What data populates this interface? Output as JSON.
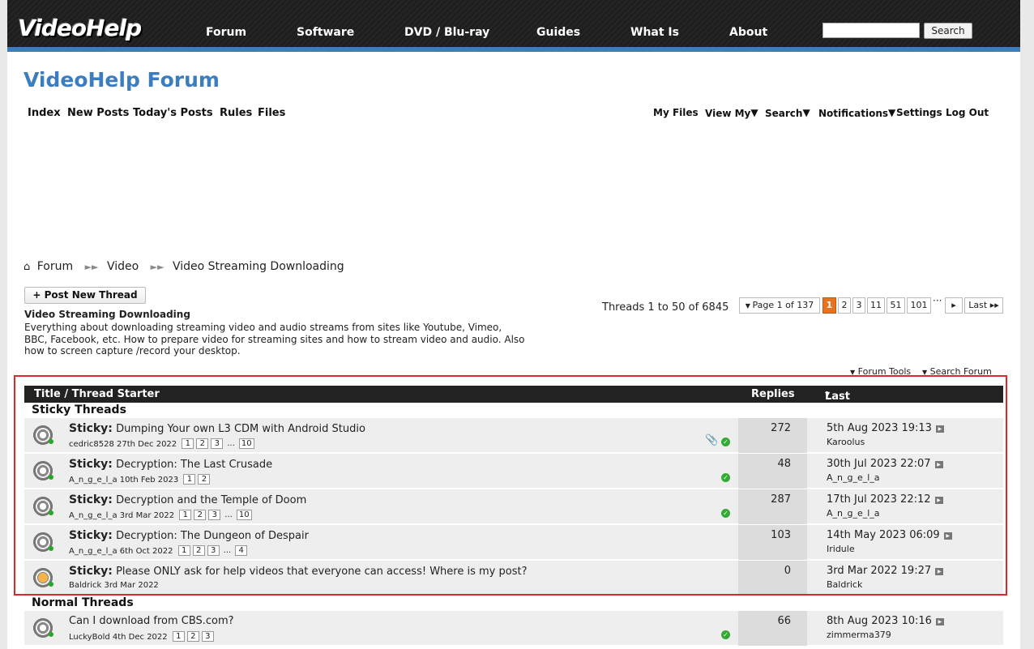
{
  "header": {
    "logo": "VideoHelp",
    "nav": [
      "Forum",
      "Software",
      "DVD / Blu-ray",
      "Guides",
      "What Is",
      "About"
    ],
    "search_button": "Search",
    "search_value": ""
  },
  "forum_title": "VideoHelp Forum",
  "subnav_left": [
    "Index",
    "New Posts",
    "Today's Posts",
    "Rules",
    "Files"
  ],
  "subnav_right": [
    "My Files",
    "View My",
    "Search",
    "Notifications",
    "Settings",
    "Log Out"
  ],
  "breadcrumb": [
    "Forum",
    "Video",
    "Video Streaming Downloading"
  ],
  "post_new_thread": "+ Post New Thread",
  "forum": {
    "name": "Video Streaming Downloading",
    "description": "Everything about downloading streaming video and audio streams from sites like Youtube, Vimeo, BBC, Facebook, etc. How to prepare video for streaming sites and how to stream video and audio. Also how to screen capture /record your desktop."
  },
  "threads_count": "Threads 1 to 50 of 6845",
  "pager": {
    "label": "Page 1 of 137",
    "pages": [
      "1",
      "2",
      "3",
      "11",
      "51",
      "101"
    ],
    "current": "1",
    "last": "Last"
  },
  "tools": {
    "forum_tools": "Forum Tools",
    "search_forum": "Search Forum"
  },
  "table": {
    "col_title": "Title / Thread Starter",
    "col_replies": "Replies",
    "col_last": "Last Post By"
  },
  "sections": {
    "sticky": "Sticky Threads",
    "normal": "Normal Threads"
  },
  "sticky_label": "Sticky:",
  "threads": [
    {
      "title": "Dumping Your own L3 CDM with Android Studio",
      "starter": "cedric8528 27th Dec 2022",
      "pages": [
        "1",
        "2",
        "3",
        "...",
        "10"
      ],
      "replies": "272",
      "last_date": "5th Aug 2023 19:13",
      "last_user": "Karoolus"
    },
    {
      "title": "Decryption: The Last Crusade",
      "starter": "A_n_g_e_l_a 10th Feb 2023",
      "pages": [
        "1",
        "2"
      ],
      "replies": "48",
      "last_date": "30th Jul 2023 22:07",
      "last_user": "A_n_g_e_l_a"
    },
    {
      "title": "Decryption and the Temple of Doom",
      "starter": "A_n_g_e_l_a 3rd Mar 2022",
      "pages": [
        "1",
        "2",
        "3",
        "...",
        "10"
      ],
      "replies": "287",
      "last_date": "17th Jul 2023 22:12",
      "last_user": "A_n_g_e_l_a"
    },
    {
      "title": "Decryption: The Dungeon of Despair",
      "starter": "A_n_g_e_l_a 6th Oct 2022",
      "pages": [
        "1",
        "2",
        "3",
        "...",
        "4"
      ],
      "replies": "103",
      "last_date": "14th May 2023 06:09",
      "last_user": "Iridule"
    },
    {
      "title": "Please ONLY ask for help videos that everyone can access! Where is my post?",
      "starter": "Baldrick 3rd Mar 2022",
      "pages": [],
      "replies": "0",
      "last_date": "3rd Mar 2022 19:27",
      "last_user": "Baldrick"
    },
    {
      "title": "Can I download from CBS.com?",
      "starter": "LuckyBold 4th Dec 2022",
      "pages": [
        "1",
        "2",
        "3"
      ],
      "replies": "66",
      "last_date": "8th Aug 2023 10:16",
      "last_user": "zimmerma379"
    }
  ]
}
